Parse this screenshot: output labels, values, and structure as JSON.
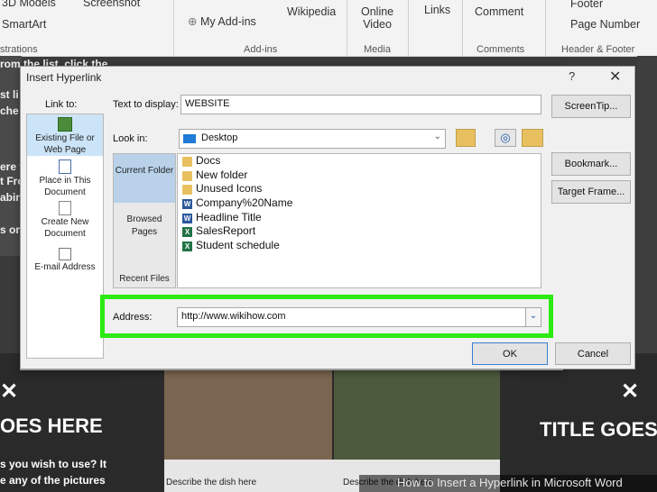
{
  "ribbon": {
    "items": {
      "models": "3D Models",
      "screenshot": "Screenshot",
      "smartart": "SmartArt",
      "my_addins": "My Add-ins",
      "wikipedia": "Wikipedia",
      "online_video": "Online\nVideo",
      "links": "Links",
      "comment": "Comment",
      "footer": "Footer",
      "page_number": "Page Number"
    },
    "groups": {
      "illustrations": "strations",
      "addins": "Add-ins",
      "media": "Media",
      "comments": "Comments",
      "header_footer": "Header & Footer"
    }
  },
  "background": {
    "left_lines": [
      "rom the list, click the",
      "st li",
      "che",
      "ere f",
      "t Fro",
      "abin",
      "s or"
    ],
    "title_left": "OES HERE",
    "title_right": "TITLE GOES",
    "left_text_lines": [
      "s you wish to use? It",
      "e any of the pictures"
    ],
    "caption_1": "Describe the dish here",
    "caption_2": "Describe the dish here",
    "watermark": "How to Insert a Hyperlink in Microsoft Word"
  },
  "dialog": {
    "title": "Insert Hyperlink",
    "help": "?",
    "close": "✕",
    "link_to_label": "Link to:",
    "text_to_display_label": "Text to display:",
    "text_to_display_value": "WEBSITE",
    "look_in_label": "Look in:",
    "look_in_value": "Desktop",
    "address_label": "Address:",
    "address_value": "http://www.wikihow.com",
    "link_to_items": [
      {
        "label": "Existing File or Web Page",
        "selected": true,
        "icon": "globe-file-icon"
      },
      {
        "label": "Place in This Document",
        "selected": false,
        "icon": "document-place-icon"
      },
      {
        "label": "Create New Document",
        "selected": false,
        "icon": "new-document-icon"
      },
      {
        "label": "E-mail Address",
        "selected": false,
        "icon": "email-icon"
      }
    ],
    "nav_items": [
      {
        "label": "Current Folder",
        "selected": true
      },
      {
        "label": "Browsed Pages",
        "selected": false
      },
      {
        "label": "Recent Files",
        "selected": false
      }
    ],
    "files": [
      {
        "name": "Docs",
        "type": "folder"
      },
      {
        "name": "New folder",
        "type": "folder"
      },
      {
        "name": "Unused Icons",
        "type": "folder"
      },
      {
        "name": "Company%20Name",
        "type": "word"
      },
      {
        "name": "Headline Title",
        "type": "word"
      },
      {
        "name": "SalesReport",
        "type": "excel"
      },
      {
        "name": "Student schedule",
        "type": "excel"
      }
    ],
    "buttons": {
      "screentip": "ScreenTip...",
      "bookmark": "Bookmark...",
      "target_frame": "Target Frame...",
      "ok": "OK",
      "cancel": "Cancel"
    }
  },
  "colors": {
    "highlight": "#2cea12",
    "selection": "#cce4f7"
  }
}
